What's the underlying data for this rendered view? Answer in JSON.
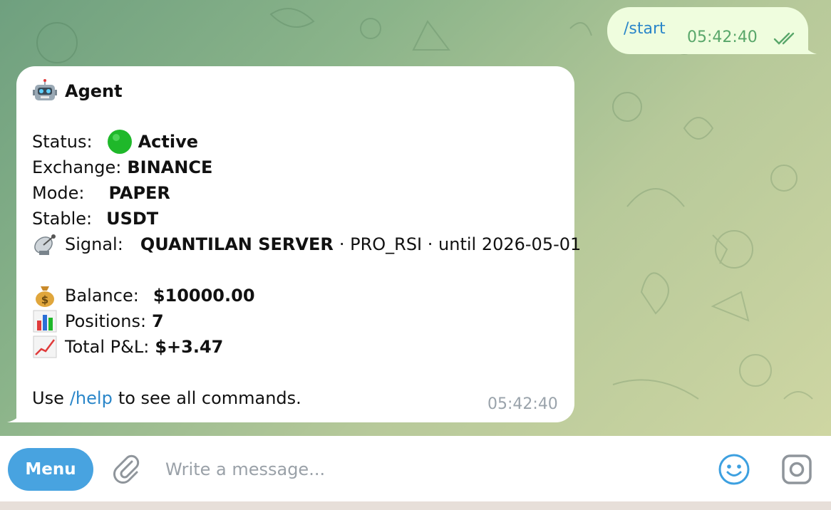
{
  "outgoing": {
    "text": "/start",
    "time": "05:42:40",
    "status_icon": "double-check-icon"
  },
  "incoming": {
    "title_emoji": "robot-emoji",
    "title": "Agent",
    "status_label": "Status:",
    "status_emoji": "green-circle-emoji",
    "status_value": "Active",
    "exchange_label": "Exchange:",
    "exchange_value": "BINANCE",
    "mode_label": "Mode:",
    "mode_value": "PAPER",
    "stable_label": "Stable:",
    "stable_value": "USDT",
    "signal_emoji": "satellite-antenna-emoji",
    "signal_label": "Signal:",
    "signal_server": "QUANTILAN SERVER",
    "signal_rest": "· PRO_RSI · until 2026-05-01",
    "balance_emoji": "money-bag-emoji",
    "balance_label": "Balance:",
    "balance_value": "$10000.00",
    "positions_emoji": "bar-chart-emoji",
    "positions_label": "Positions:",
    "positions_value": "7",
    "pnl_emoji": "chart-increasing-emoji",
    "pnl_label": "Total P&L:",
    "pnl_value": "$+3.47",
    "help_prefix": "Use",
    "help_link": "/help",
    "help_suffix": "to see all commands.",
    "time": "05:42:40"
  },
  "composer": {
    "menu_label": "Menu",
    "placeholder": "Write a message...",
    "attach_icon": "paperclip-icon",
    "emoji_icon": "smiley-icon",
    "camera_icon": "camera-icon"
  },
  "colors": {
    "outgoing_bubble": "#effdde",
    "incoming_bubble": "#ffffff",
    "link": "#2a86c9",
    "menu_button": "#48a3e0",
    "time_outgoing": "#59a76a",
    "time_incoming": "#9aa3ab"
  }
}
